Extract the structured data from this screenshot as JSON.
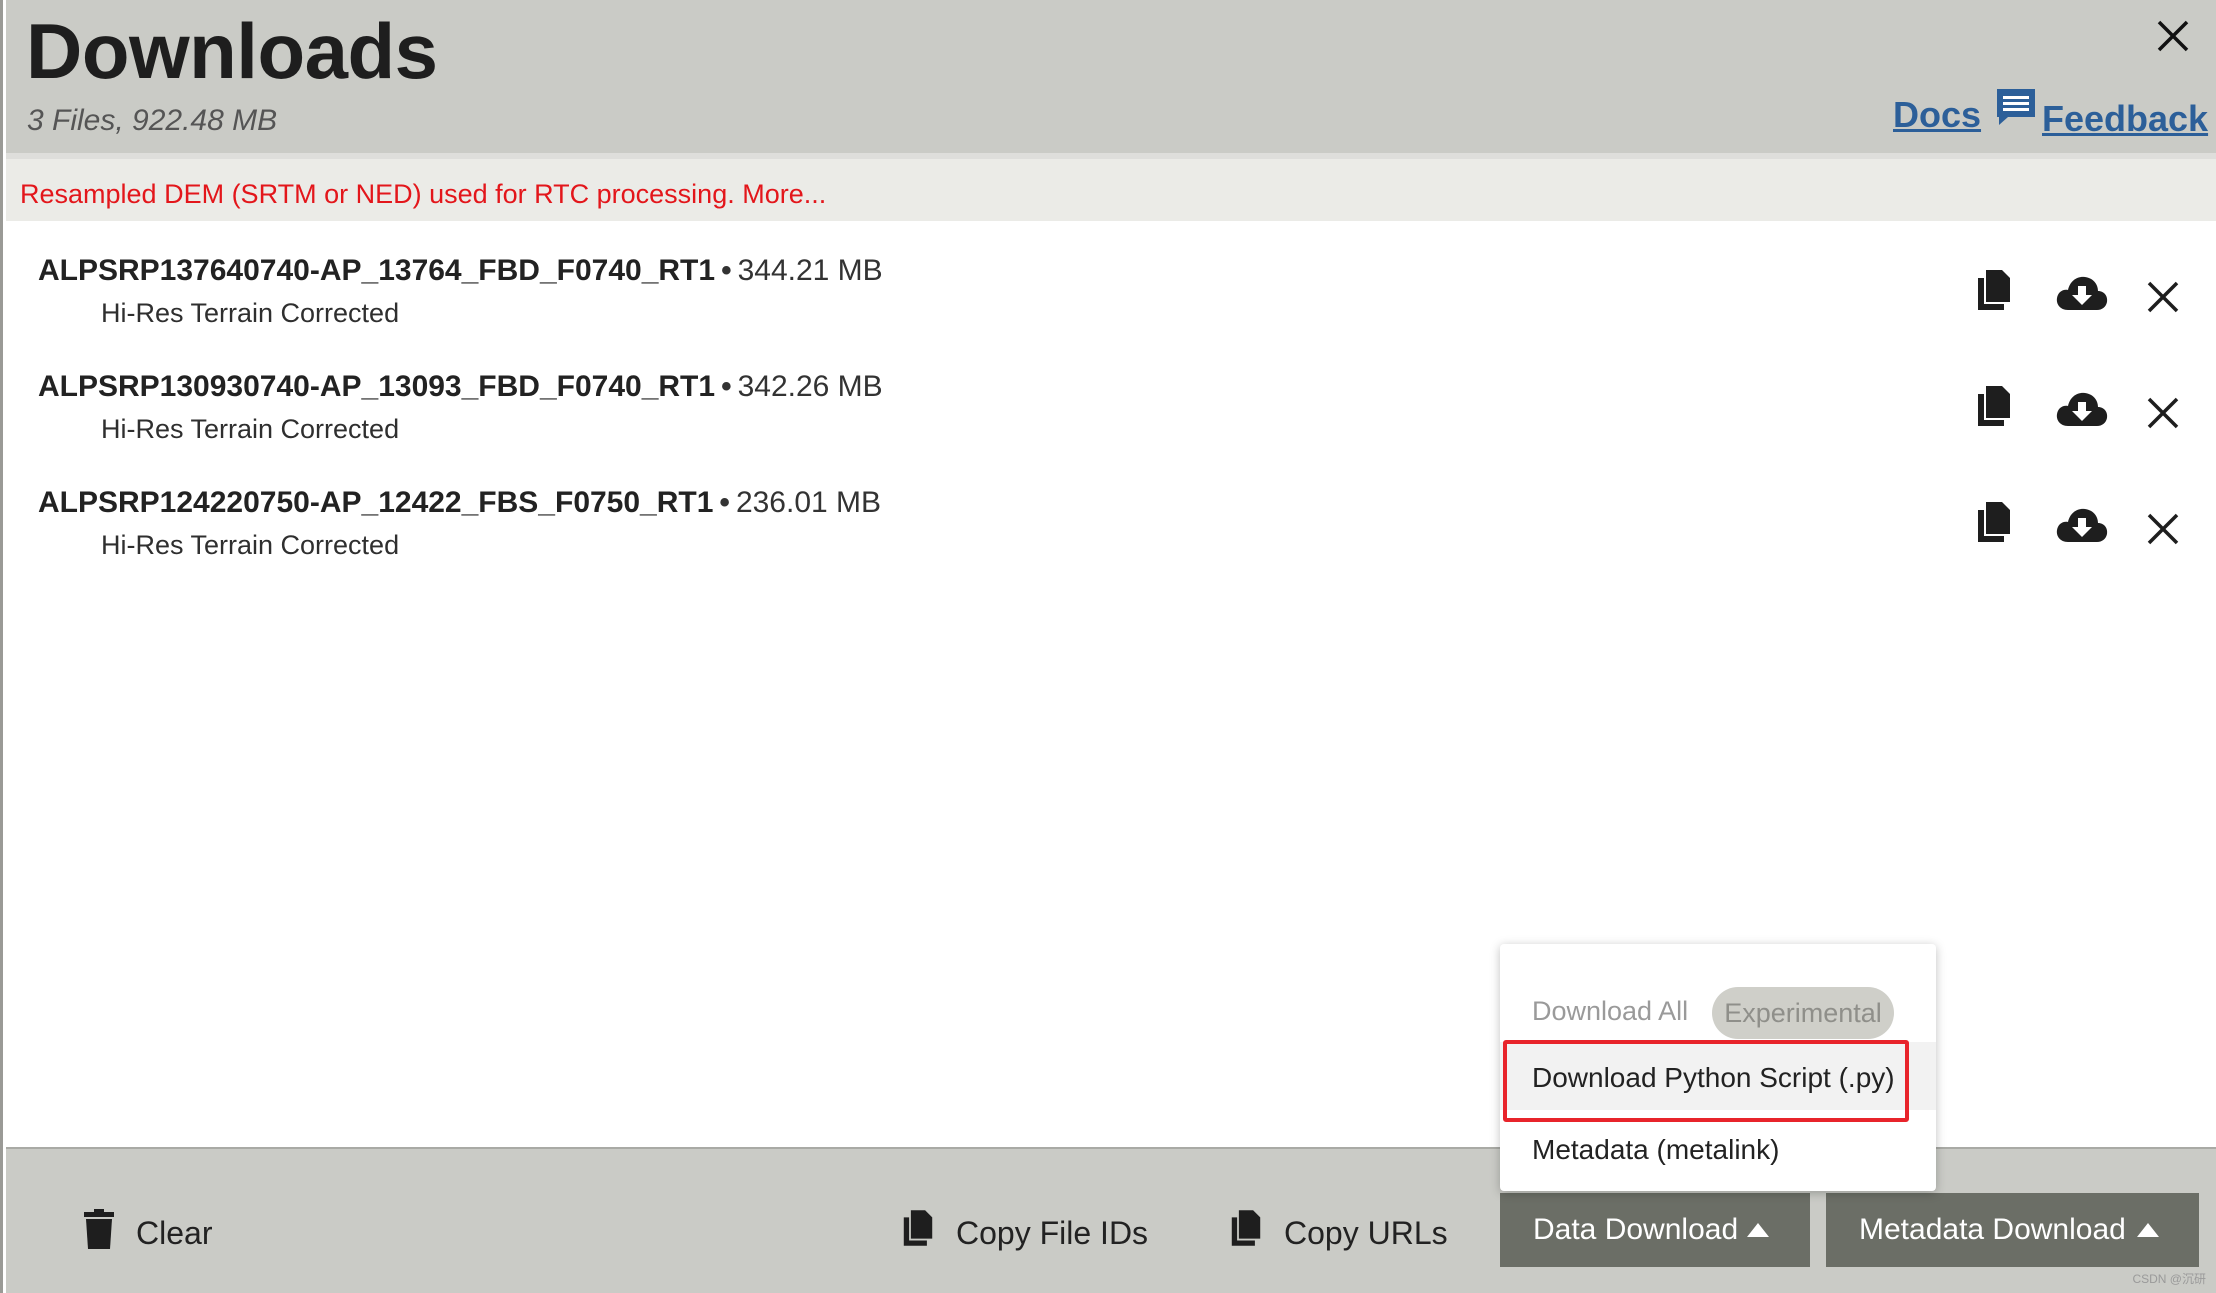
{
  "header": {
    "title": "Downloads",
    "subtitle": "3 Files, 922.48 MB",
    "docs_label": "Docs",
    "feedback_label": "Feedback"
  },
  "notice": {
    "text": "Resampled DEM (SRTM or NED) used for RTC processing. More..."
  },
  "files": [
    {
      "name": "ALPSRP137640740-AP_13764_FBD_F0740_RT1",
      "size": "344.21 MB",
      "type": "Hi-Res Terrain Corrected"
    },
    {
      "name": "ALPSRP130930740-AP_13093_FBD_F0740_RT1",
      "size": "342.26 MB",
      "type": "Hi-Res Terrain Corrected"
    },
    {
      "name": "ALPSRP124220750-AP_12422_FBS_F0750_RT1",
      "size": "236.01 MB",
      "type": "Hi-Res Terrain Corrected"
    }
  ],
  "menu": {
    "download_all": "Download All",
    "experimental_badge": "Experimental",
    "python_script": "Download Python Script (.py)",
    "metalink": "Metadata (metalink)"
  },
  "footer": {
    "clear": "Clear",
    "copy_file_ids": "Copy File IDs",
    "copy_urls": "Copy URLs",
    "data_download": "Data Download",
    "metadata_download": "Metadata Download"
  },
  "watermark": "CSDN @沉研",
  "colors": {
    "header_bg": "#cacbc6",
    "link": "#2c5f99",
    "notice_text": "#e3161b",
    "highlight": "#e8242b",
    "button_bg": "#6b6e66"
  },
  "icons": {
    "close": "close-icon",
    "feedback": "comment-icon",
    "copy": "copy-icon",
    "download": "cloud-download-icon",
    "remove": "close-icon",
    "trash": "trash-icon",
    "caret": "caret-up-icon"
  }
}
